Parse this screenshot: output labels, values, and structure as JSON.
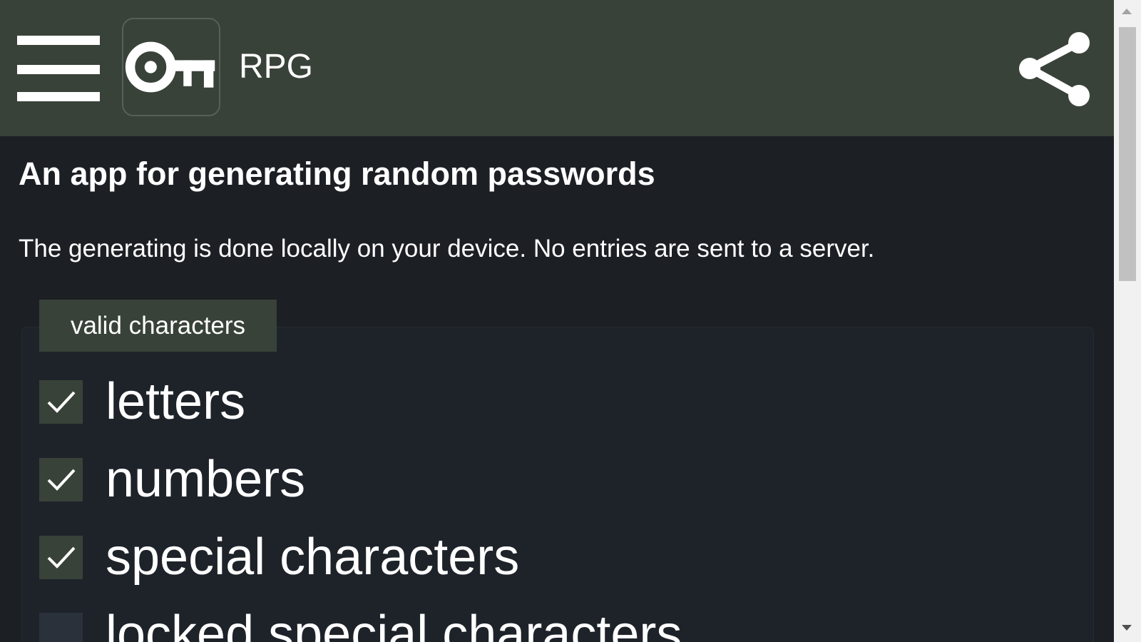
{
  "header": {
    "app_name": "RPG",
    "menu_icon": "hamburger-menu-icon",
    "logo_icon": "key-icon",
    "share_icon": "share-icon",
    "bar_color": "#394239"
  },
  "main": {
    "heading": "An app for generating random passwords",
    "description": "The generating is done locally on your device. No entries are sent to a server.",
    "valid_characters": {
      "legend": "valid characters",
      "options": [
        {
          "label": "letters",
          "checked": true
        },
        {
          "label": "numbers",
          "checked": true
        },
        {
          "label": "special characters",
          "checked": true
        },
        {
          "label": "locked special characters",
          "checked": false
        }
      ]
    }
  },
  "colors": {
    "background": "#1c1f24",
    "accent": "#394239",
    "text": "#ffffff"
  }
}
